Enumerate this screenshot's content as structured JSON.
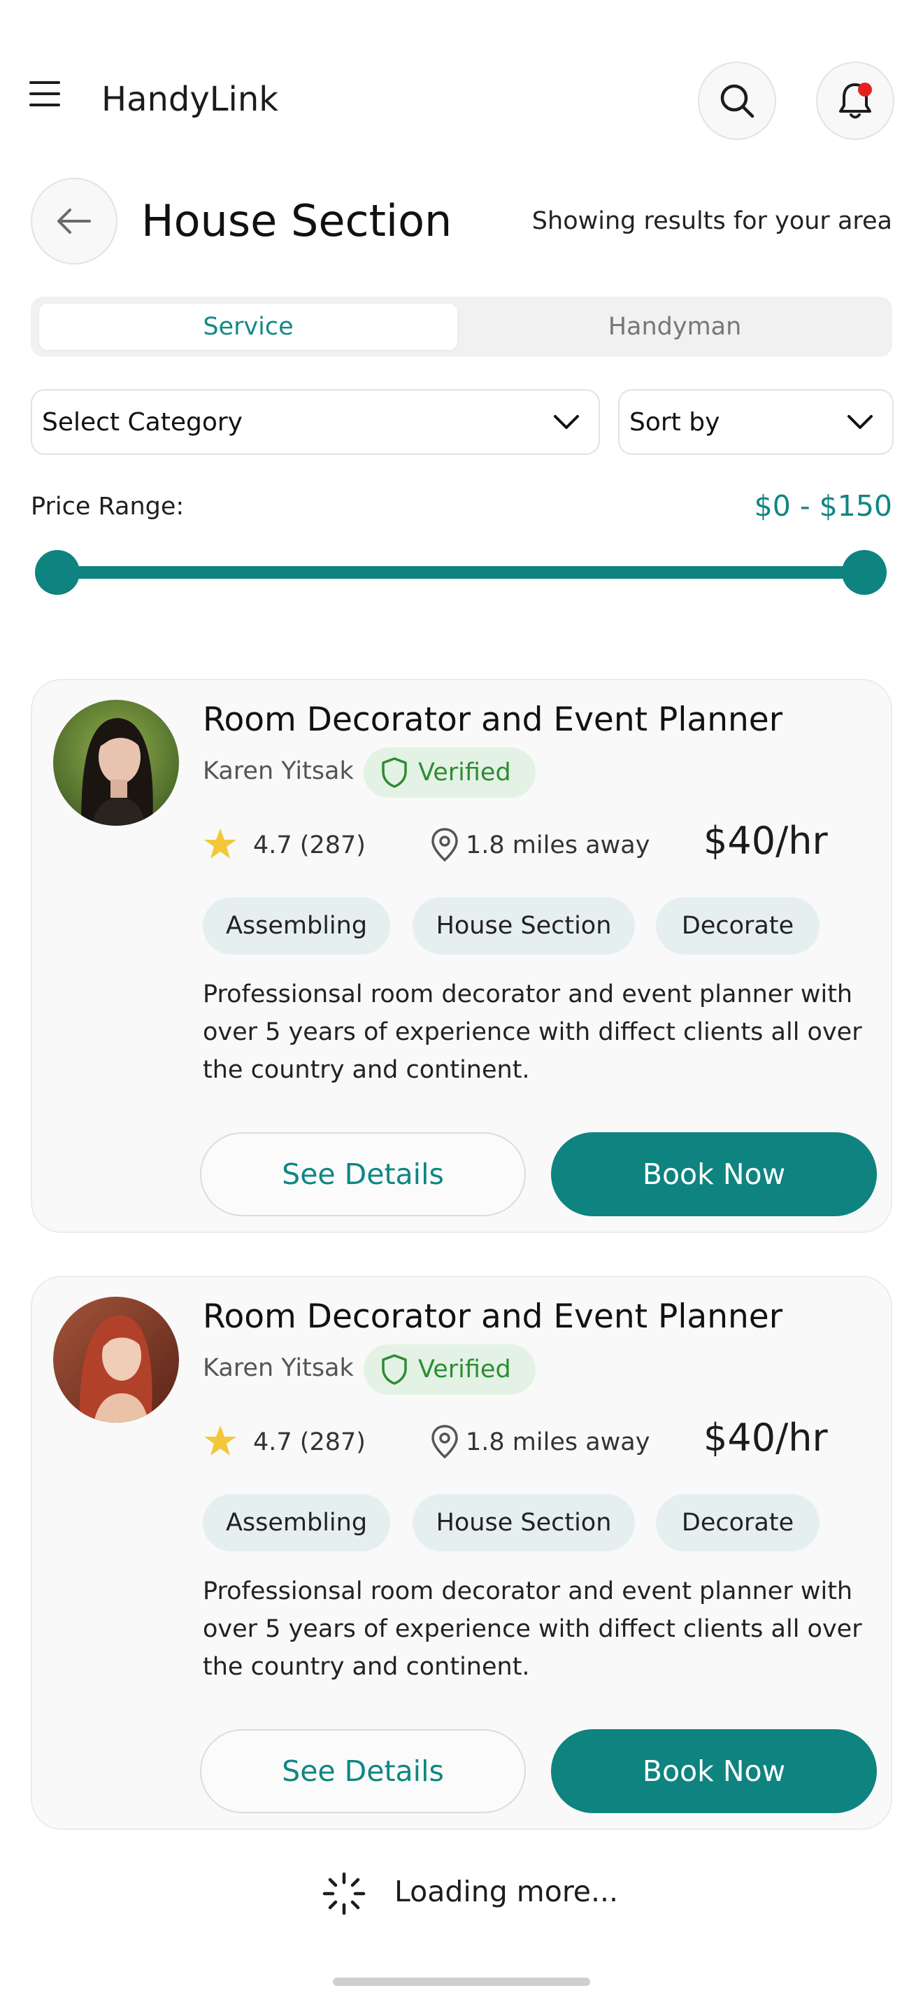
{
  "app": {
    "title": "HandyLink",
    "menu_icon": "hamburger-icon",
    "search_icon": "search-icon",
    "notification_icon": "bell-icon",
    "notification_dot_color": "#e62020"
  },
  "header": {
    "back_icon": "arrow-left-icon",
    "title": "House Section",
    "area_note": "Showing results for your area"
  },
  "tabs": [
    {
      "label": "Service",
      "active": true
    },
    {
      "label": "Handyman",
      "active": false
    }
  ],
  "filters": {
    "category": {
      "value": "Select Category",
      "icon": "chevron-down-icon"
    },
    "sort": {
      "value": "Sort by",
      "icon": "chevron-down-icon"
    }
  },
  "price_range": {
    "label": "Price Range:",
    "value_text": "$0 - $150",
    "min": 0,
    "max": 150
  },
  "listings": [
    {
      "title": "Room Decorator and Event Planner",
      "name": "Karen Yitsak",
      "badge": "Verified",
      "rating": "4.7 (287)",
      "distance": "1.8 miles away",
      "rate": "$40/hr",
      "tags": [
        "Assembling",
        "House Section",
        "Decorate"
      ],
      "description": "Professionsal room decorator and event  planner with over 5 years of experience with diffect clients all over the country and continent.",
      "details_label": "See Details",
      "book_label": "Book Now"
    },
    {
      "title": "Room Decorator and Event Planner",
      "name": "Karen Yitsak",
      "badge": "Verified",
      "rating": "4.7 (287)",
      "distance": "1.8 miles away",
      "rate": "$40/hr",
      "tags": [
        "Assembling",
        "House Section",
        "Decorate"
      ],
      "description": "Professionsal room decorator and event  planner with over 5 years of experience with diffect clients all over the country and continent.",
      "details_label": "See Details",
      "book_label": "Book Now"
    }
  ],
  "loading": {
    "text": "Loading more...",
    "icon": "spinner-icon"
  },
  "colors": {
    "accent": "#0e8380",
    "verified_bg": "#e3f2e4",
    "verified_text": "#2e8b34",
    "star": "#f2c73a",
    "tag_bg": "#e6efef"
  }
}
